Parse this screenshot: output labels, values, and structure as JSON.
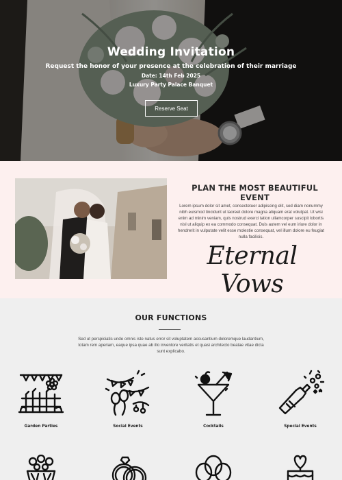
{
  "hero": {
    "title": "Wedding Invitation",
    "subtitle": "Request the honor of your presence at the celebration of their marriage",
    "date": "Date: 14th Feb 2025",
    "venue": "Luxury Party Palace Banquet",
    "button_label": "Reserve Seat"
  },
  "plan": {
    "heading": "PLAN THE MOST BEAUTIFUL EVENT",
    "body": "Lorem ipsum dolor sit amet, consectetuer adipiscing elit, sed diam nonummy nibh euismod tincidunt ut laoreet dolore magna aliquam erat volutpat. Ut wisi enim ad minim veniam, quis nostrud exerci tation ullamcorper suscipit lobortis nisl ut aliquip ex ea commodo consequat. Duis autem vel eum iriure dolor in hendrerit in vulputate velit esse molestie consequat, vel illum dolore eu feugiat nulla facilisis.",
    "script_text": "Eternal Vows"
  },
  "functions": {
    "heading": "OUR FUNCTIONS",
    "description": "Sed ut perspiciatis unde omnis iste natus error sit voluptatem accusantium doloremque laudantium, totam rem aperiam, eaque ipsa quae ab illo inventore veritatis et quasi architecto beatae vitae dicta sunt explicabo.",
    "items": [
      {
        "label": "Garden Parties",
        "icon": "garden-party-icon"
      },
      {
        "label": "Social Events",
        "icon": "social-events-icon"
      },
      {
        "label": "Cocktails",
        "icon": "cocktail-icon"
      },
      {
        "label": "Special Events",
        "icon": "champagne-icon"
      }
    ],
    "second_row_icons": [
      "flower-basket-icon",
      "rings-icon",
      "balloons-icon",
      "heart-cake-icon"
    ]
  }
}
